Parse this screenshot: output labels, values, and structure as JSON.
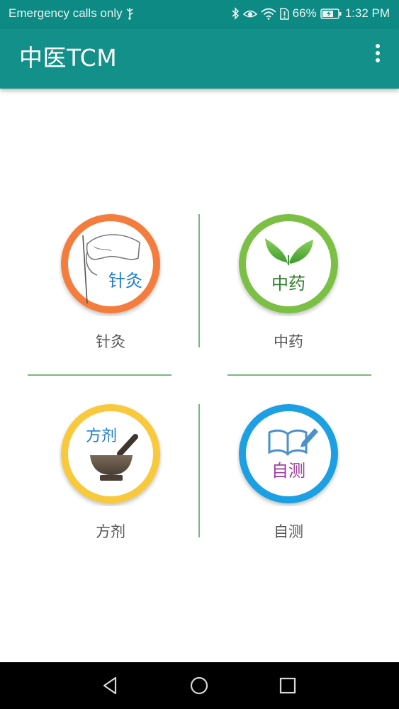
{
  "status_bar": {
    "carrier_text": "Emergency calls only",
    "battery": "66%",
    "time": "1:32 PM"
  },
  "app_bar": {
    "title": "中医TCM"
  },
  "tiles": [
    {
      "label": "针灸",
      "icon_text": "针灸",
      "ring_color": "#f47c3c",
      "icon": "acupuncture-hand-icon"
    },
    {
      "label": "中药",
      "icon_text": "中药",
      "ring_color": "#7cbf45",
      "icon": "herb-leaves-icon"
    },
    {
      "label": "方剂",
      "icon_text": "方剂",
      "ring_color": "#f8c93c",
      "icon": "mortar-pestle-icon"
    },
    {
      "label": "自测",
      "icon_text": "自测",
      "ring_color": "#1e9fe3",
      "icon": "book-pen-icon"
    }
  ],
  "colors": {
    "status_bar": "#0e8a85",
    "app_bar": "#13908a",
    "divider": "#7cb87c"
  }
}
